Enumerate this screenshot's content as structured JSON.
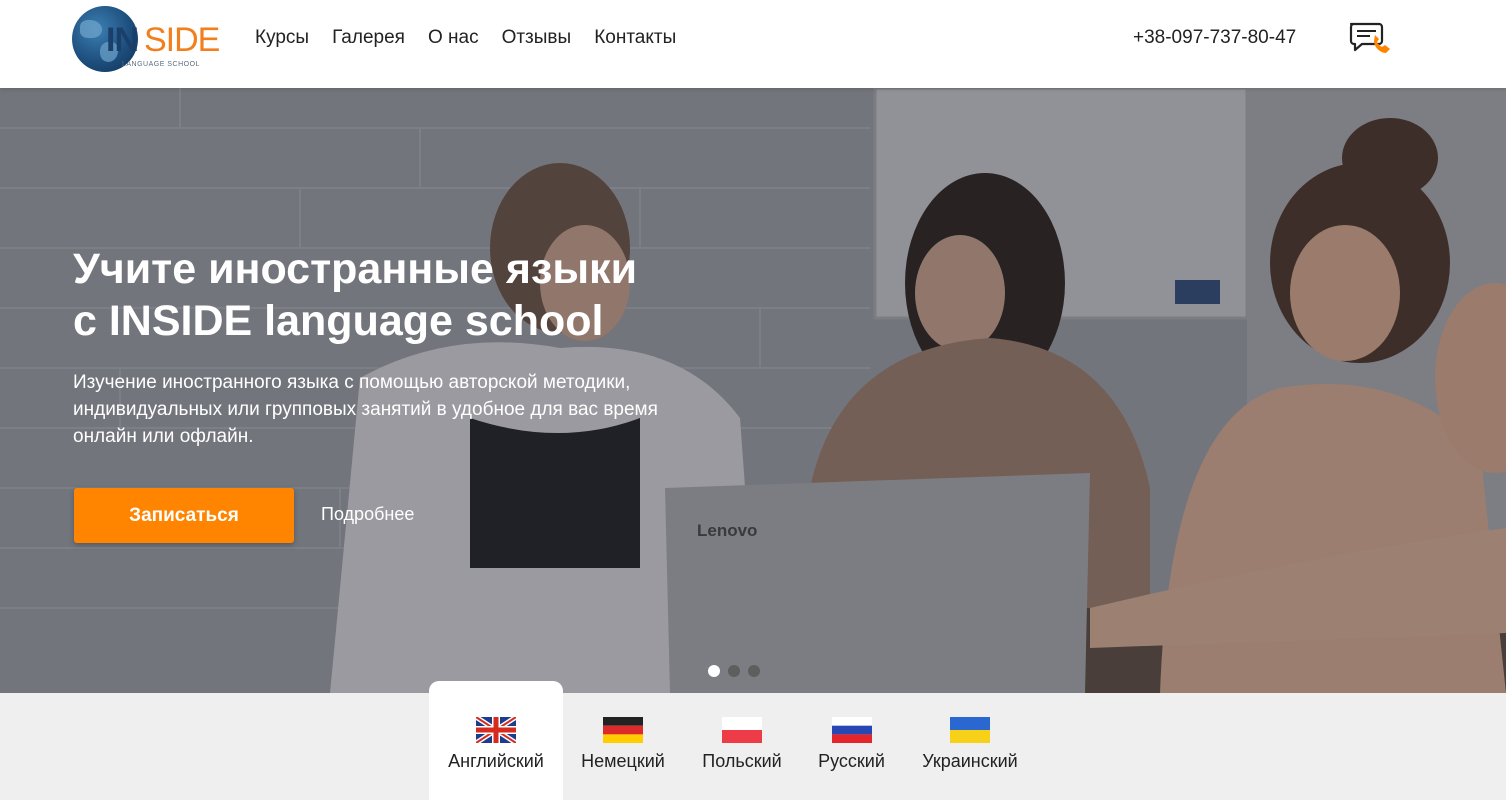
{
  "header": {
    "logo": {
      "main_left": "IN",
      "main_right": "SIDE",
      "subtitle": "LANGUAGE SCHOOL"
    },
    "nav": [
      {
        "label": "Курсы"
      },
      {
        "label": "Галерея"
      },
      {
        "label": "О нас"
      },
      {
        "label": "Отзывы"
      },
      {
        "label": "Контакты"
      }
    ],
    "phone": "+38-097-737-80-47",
    "contact_icon": "chat-phone-icon"
  },
  "hero": {
    "title_line1": "Учите иностранные языки",
    "title_line2": "с INSIDE language school",
    "description": "Изучение иностранного языка с помощью авторской методики, индивидуальных или групповых занятий в удобное для вас время онлайн или офлайн.",
    "primary_button": "Записаться",
    "secondary_link": "Подробнее",
    "slides_total": 3,
    "active_slide": 1
  },
  "languages": {
    "active_index": 0,
    "items": [
      {
        "label": "Английский",
        "flag_icon": "uk-flag-icon"
      },
      {
        "label": "Немецкий",
        "flag_icon": "germany-flag-icon"
      },
      {
        "label": "Польский",
        "flag_icon": "poland-flag-icon"
      },
      {
        "label": "Русский",
        "flag_icon": "russia-flag-icon"
      },
      {
        "label": "Украинский",
        "flag_icon": "ukraine-flag-icon"
      }
    ]
  },
  "colors": {
    "accent": "#ff8400",
    "logo_blue": "#1b3f6a",
    "logo_orange": "#f27f1b"
  }
}
